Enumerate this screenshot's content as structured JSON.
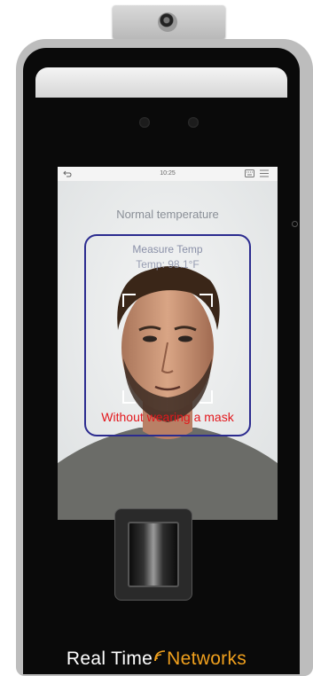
{
  "screen": {
    "clock": "10:25",
    "notice": "Normal temperature",
    "measure_label": "Measure Temp",
    "temperature": "Temp: 98.1°F",
    "alert": "Without wearing a mask"
  },
  "icons": {
    "back": "back-arrow-icon",
    "keyboard": "keyboard-icon",
    "menu": "menu-icon"
  },
  "brand": {
    "part1": "Real Time",
    "part2": "Networks"
  },
  "colors": {
    "frame": "#2b2b8f",
    "alert": "#e3181d",
    "brand_accent": "#f0a01d"
  }
}
